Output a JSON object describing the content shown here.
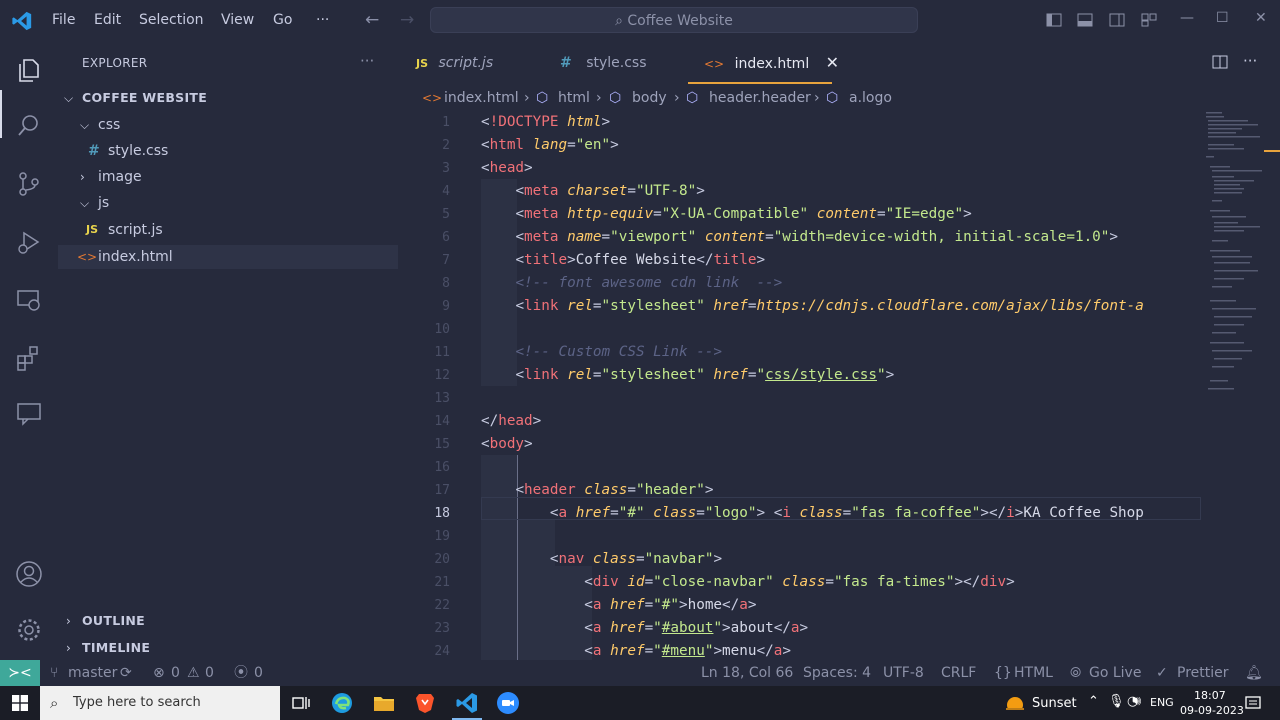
{
  "titlebar": {
    "menus": [
      "File",
      "Edit",
      "Selection",
      "View",
      "Go",
      "···"
    ],
    "search": "Coffee Website"
  },
  "sidebar": {
    "title": "EXPLORER",
    "dots": "···",
    "project": "COFFEE WEBSITE",
    "items": [
      {
        "label": "css",
        "kind": "folder-open"
      },
      {
        "label": "style.css",
        "kind": "css-file"
      },
      {
        "label": "image",
        "kind": "folder-closed"
      },
      {
        "label": "js",
        "kind": "folder-open"
      },
      {
        "label": "script.js",
        "kind": "js-file"
      },
      {
        "label": "index.html",
        "kind": "html-file"
      }
    ],
    "outline": "OUTLINE",
    "timeline": "TIMELINE"
  },
  "tabs": [
    {
      "label": "script.js",
      "icon": "JS"
    },
    {
      "label": "style.css",
      "icon": "#"
    },
    {
      "label": "index.html",
      "icon": "<>",
      "active": true
    }
  ],
  "breadcrumbs": [
    "index.html",
    "html",
    "body",
    "header.header",
    "a.logo"
  ],
  "editor": {
    "current_line": 18,
    "lines": [
      "<!DOCTYPE html>",
      "<html lang=\"en\">",
      "<head>",
      "    <meta charset=\"UTF-8\">",
      "    <meta http-equiv=\"X-UA-Compatible\" content=\"IE=edge\">",
      "    <meta name=\"viewport\" content=\"width=device-width, initial-scale=1.0\">",
      "    <title>Coffee Website</title>",
      "    <!-- font awesome cdn link  -->",
      "    <link rel=\"stylesheet\" href=\"https://cdnjs.cloudflare.com/ajax/libs/font-a",
      "",
      "    <!-- Custom CSS Link -->",
      "    <link rel=\"stylesheet\" href=\"css/style.css\">",
      "",
      "</head>",
      "<body>",
      "",
      "    <header class=\"header\">",
      "        <a href=\"#\" class=\"logo\"> <i class=\"fas fa-coffee\"></i>KA Coffee Shop",
      "",
      "        <nav class=\"navbar\">",
      "            <div id=\"close-navbar\" class=\"fas fa-times\"></div>",
      "            <a href=\"#\">home</a>",
      "            <a href=\"#about\">about</a>",
      "            <a href=\"#menu\">menu</a>"
    ]
  },
  "statusbar": {
    "branch": "master",
    "errors": "0",
    "warnings": "0",
    "ports": "0",
    "position": "Ln 18, Col 66",
    "spaces": "Spaces: 4",
    "encoding": "UTF-8",
    "eol": "CRLF",
    "language": "HTML",
    "golive": "Go Live",
    "prettier": "Prettier"
  },
  "taskbar": {
    "search_placeholder": "Type here to search",
    "weather": "Sunset",
    "lang": "ENG",
    "time": "18:07",
    "date": "09-09-2023"
  }
}
